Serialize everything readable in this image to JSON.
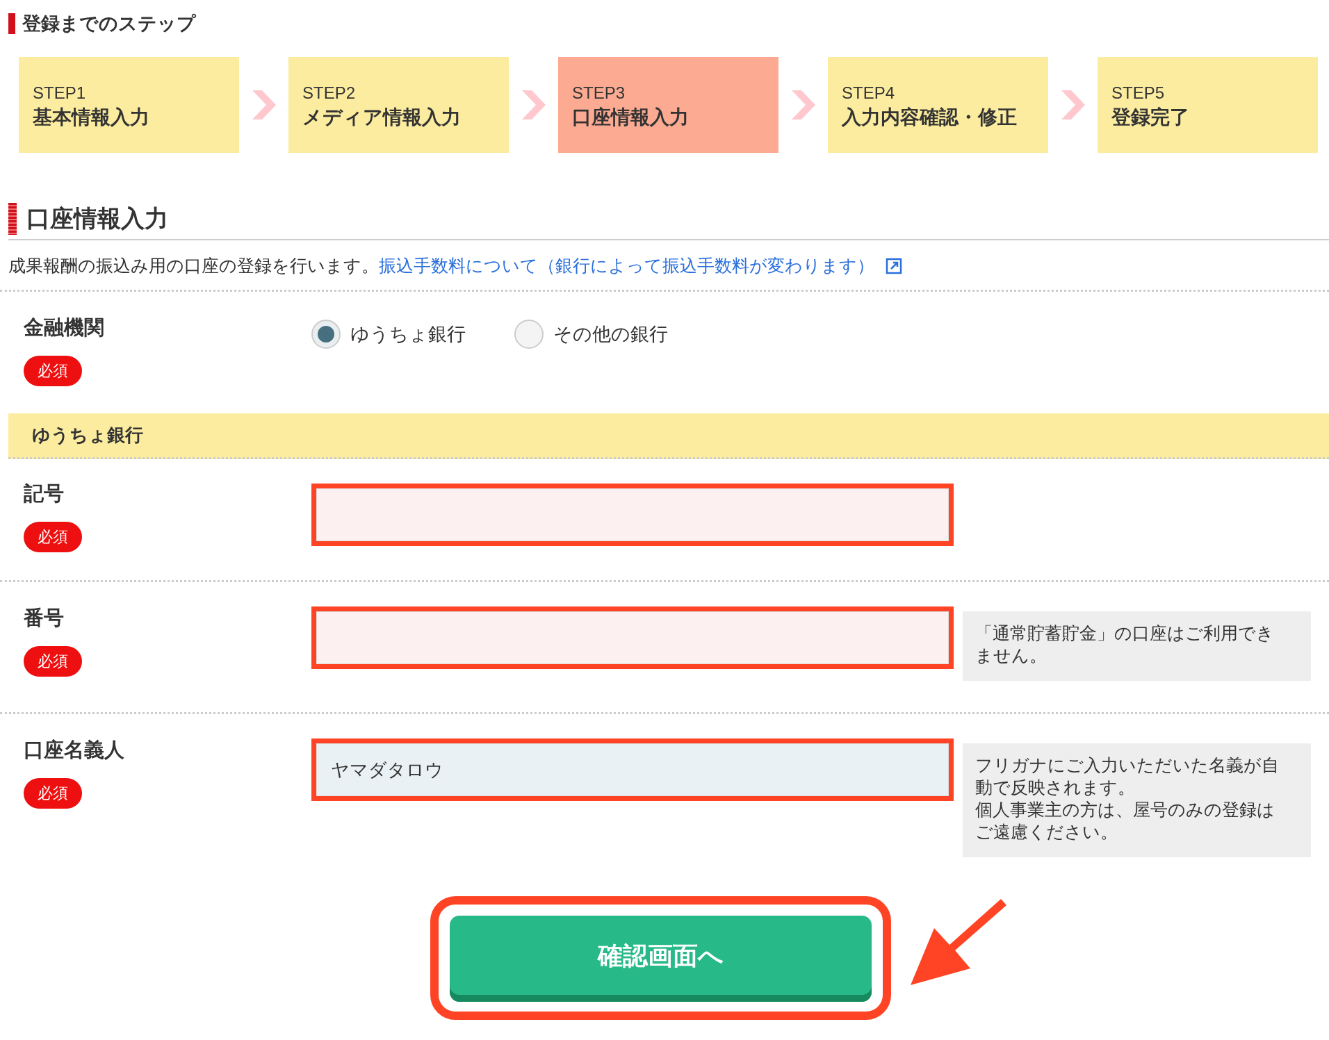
{
  "steps_heading": "登録までのステップ",
  "steps": [
    {
      "number": "STEP1",
      "label": "基本情報入力",
      "selected": false
    },
    {
      "number": "STEP2",
      "label": "メディア情報入力",
      "selected": false
    },
    {
      "number": "STEP3",
      "label": "口座情報入力",
      "selected": true
    },
    {
      "number": "STEP4",
      "label": "入力内容確認・修正",
      "selected": false
    },
    {
      "number": "STEP5",
      "label": "登録完了",
      "selected": false
    }
  ],
  "section": {
    "title": "口座情報入力",
    "description": "成果報酬の振込み用の口座の登録を行います。",
    "link": "振込手数料について（銀行によって振込手数料が変わります）"
  },
  "bank_field": {
    "label": "金融機関",
    "required_badge": "必須",
    "options": [
      {
        "label": "ゆうちょ銀行",
        "selected": true
      },
      {
        "label": "その他の銀行",
        "selected": false
      }
    ]
  },
  "subsection_title": "ゆうちょ銀行",
  "fields": [
    {
      "label": "記号",
      "required_badge": "必須",
      "error": true,
      "highlighted": true
    },
    {
      "label": "番号",
      "required_badge": "必須",
      "error": true,
      "highlighted": true,
      "note": [
        "「通常貯蓄貯金」の口座はご利用できません。"
      ]
    },
    {
      "label": "口座名義人",
      "required_badge": "必須",
      "value": "ヤマダタロウ",
      "error": false,
      "highlighted": true,
      "note": [
        "フリガナにご入力いただいた名義が自動で反映されます。",
        "個人事業主の方は、屋号のみの登録はご遠慮ください。"
      ]
    }
  ],
  "submit_button": {
    "label": "確認画面へ",
    "highlighted": true
  }
}
